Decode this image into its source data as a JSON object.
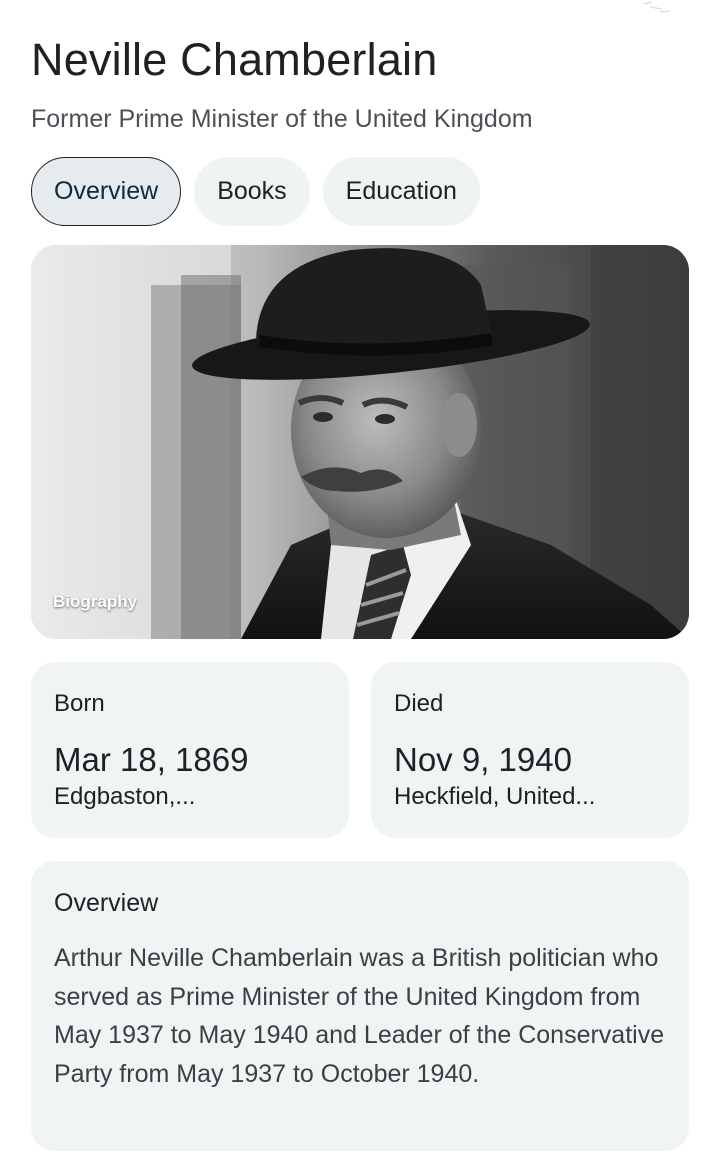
{
  "entity": {
    "name": "Neville Chamberlain",
    "description": "Former Prime Minister of the United Kingdom"
  },
  "tabs": [
    {
      "label": "Overview",
      "active": true
    },
    {
      "label": "Books",
      "active": false
    },
    {
      "label": "Education",
      "active": false
    }
  ],
  "image": {
    "caption": "Biography"
  },
  "born": {
    "label": "Born",
    "date": "Mar 18, 1869",
    "place": "Edgbaston,..."
  },
  "died": {
    "label": "Died",
    "date": "Nov 9, 1940",
    "place": "Heckfield, United..."
  },
  "overview": {
    "heading": "Overview",
    "text": "Arthur Neville Chamberlain was a British politician who served as Prime Minister of the United Kingdom from May 1937 to May 1940 and Leader of the Conservative Party from May 1937 to October 1940."
  },
  "colors": {
    "card_background": "#f0f4f4",
    "active_tab_background": "#e6ebee",
    "active_tab_border": "#202124",
    "text_primary": "#202124",
    "text_secondary": "#4d5156"
  }
}
